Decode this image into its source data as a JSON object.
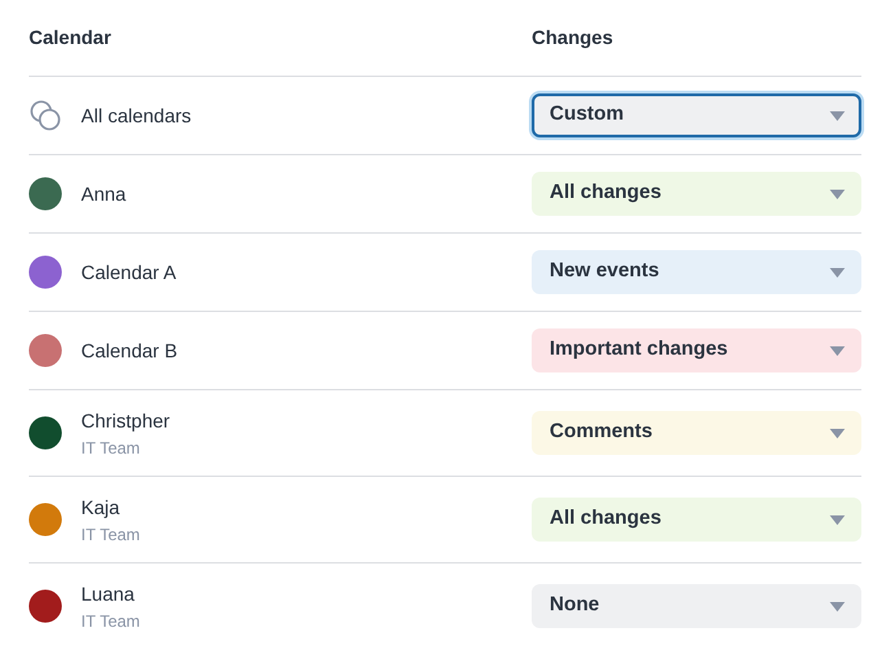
{
  "columns": [
    "Calendar",
    "Changes"
  ],
  "rows": [
    {
      "kind": "all",
      "name": "All calendars",
      "changes": {
        "value": "Custom",
        "color": "#eff0f2",
        "focused": true
      }
    },
    {
      "kind": "calendar",
      "name": "Anna",
      "color": "#3b6a51",
      "changes": {
        "value": "All changes",
        "color": "#eff8e6",
        "focused": false
      }
    },
    {
      "kind": "calendar",
      "name": "Calendar A",
      "color": "#8c62d0",
      "changes": {
        "value": "New events",
        "color": "#e6f0f9",
        "focused": false
      }
    },
    {
      "kind": "calendar",
      "name": "Calendar B",
      "color": "#c87172",
      "changes": {
        "value": "Important changes",
        "color": "#fce4e7",
        "focused": false
      }
    },
    {
      "kind": "calendar",
      "name": "Christpher",
      "team": "IT Team",
      "color": "#114d2e",
      "changes": {
        "value": "Comments",
        "color": "#fcf8e6",
        "focused": false
      }
    },
    {
      "kind": "calendar",
      "name": "Kaja",
      "team": "IT Team",
      "color": "#d27a0c",
      "changes": {
        "value": "All changes",
        "color": "#eff8e6",
        "focused": false
      }
    },
    {
      "kind": "calendar",
      "name": "Luana",
      "team": "IT Team",
      "color": "#a21c1c",
      "changes": {
        "value": "None",
        "color": "#eff0f2",
        "focused": false
      }
    }
  ]
}
